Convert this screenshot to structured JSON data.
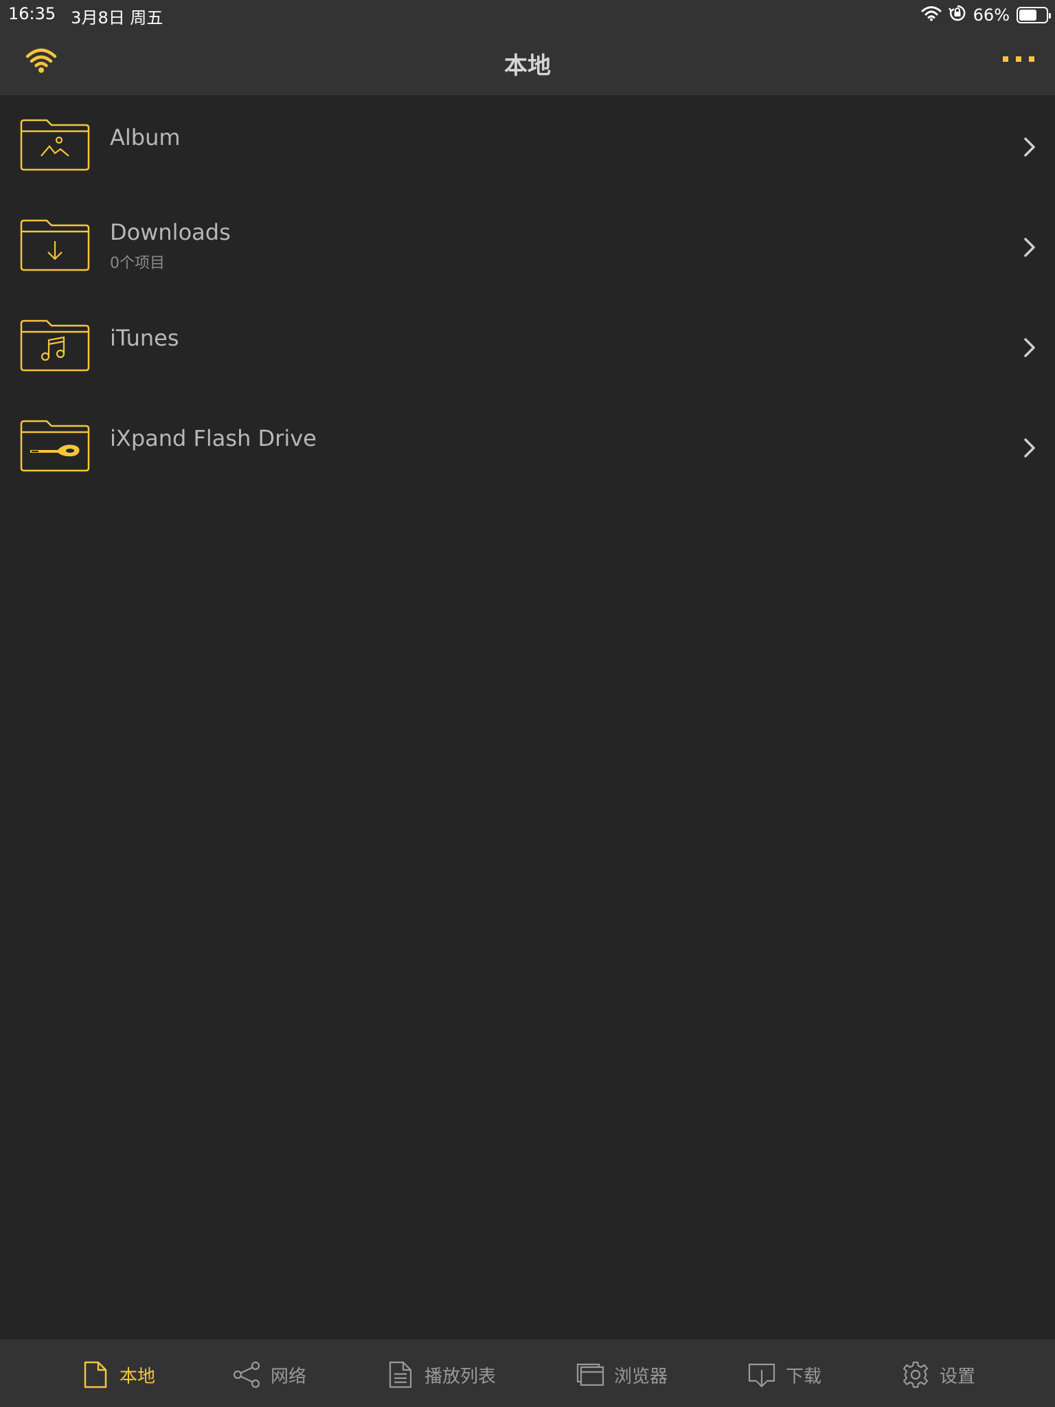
{
  "status_bar": {
    "time": "16:35",
    "date": "3月8日 周五",
    "battery_percent": "66%",
    "battery_level": 0.66,
    "icons": [
      "wifi-icon",
      "orientation-lock-icon",
      "battery-icon"
    ]
  },
  "nav": {
    "title": "本地",
    "left_icon": "wifi-icon",
    "right_icon": "more-icon"
  },
  "colors": {
    "accent": "#f5c63b",
    "background": "#252525",
    "bar": "#333333",
    "text_primary": "#b8b8b8",
    "text_secondary": "#8a8a8a"
  },
  "folders": [
    {
      "name": "Album",
      "subtitle": "",
      "icon": "album-folder-icon"
    },
    {
      "name": "Downloads",
      "subtitle": "0个项目",
      "icon": "downloads-folder-icon"
    },
    {
      "name": "iTunes",
      "subtitle": "",
      "icon": "itunes-folder-icon"
    },
    {
      "name": "iXpand Flash Drive",
      "subtitle": "",
      "icon": "flash-drive-folder-icon"
    }
  ],
  "tabs": [
    {
      "label": "本地",
      "icon": "document-icon",
      "active": true
    },
    {
      "label": "网络",
      "icon": "share-network-icon",
      "active": false
    },
    {
      "label": "播放列表",
      "icon": "playlist-icon",
      "active": false
    },
    {
      "label": "浏览器",
      "icon": "browser-icon",
      "active": false
    },
    {
      "label": "下载",
      "icon": "download-icon",
      "active": false
    },
    {
      "label": "设置",
      "icon": "settings-gear-icon",
      "active": false
    }
  ]
}
